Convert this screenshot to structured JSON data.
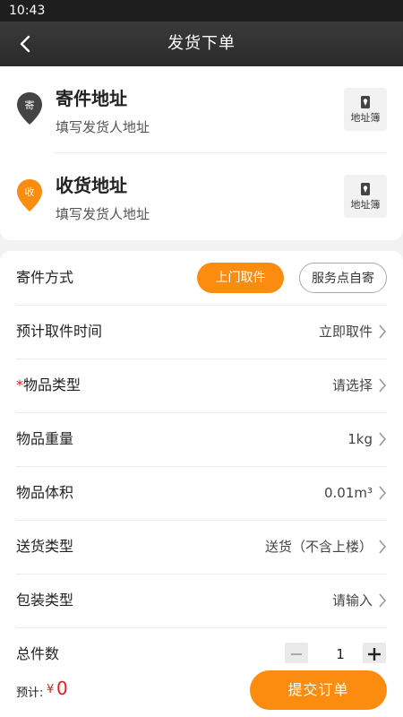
{
  "status_bar": {
    "time": "10:43"
  },
  "nav": {
    "title": "发货下单",
    "back_icon": "back-arrow-icon"
  },
  "sender": {
    "title": "寄件地址",
    "subtitle": "填写发货人地址",
    "pin_char": "寄",
    "pin_color": "#444444",
    "book_label": "地址簿"
  },
  "receiver": {
    "title": "收货地址",
    "subtitle": "填写发货人地址",
    "pin_char": "收",
    "pin_color": "#fb8c10",
    "book_label": "地址簿"
  },
  "form": {
    "ship_method": {
      "label": "寄件方式",
      "options": [
        "上门取件",
        "服务点自寄"
      ],
      "selected": "上门取件"
    },
    "pickup_time": {
      "label": "预计取件时间",
      "value": "立即取件"
    },
    "item_type": {
      "required_mark": "*",
      "label": "物品类型",
      "value": "请选择"
    },
    "weight": {
      "label": "物品重量",
      "value": "1kg"
    },
    "volume": {
      "label": "物品体积",
      "value": "0.01m³"
    },
    "delivery_type": {
      "label": "送货类型",
      "value": "送货（不含上楼）"
    },
    "packaging": {
      "label": "包装类型",
      "value": "请输入"
    },
    "count": {
      "label": "总件数",
      "value": "1",
      "minus": "−",
      "plus": "+"
    }
  },
  "footer": {
    "estimate_label": "预计:",
    "currency": "¥",
    "amount": "0",
    "submit_label": "提交订单"
  },
  "colors": {
    "accent": "#fb8c10",
    "price": "#e02020",
    "nav_bg": "#2e2e2e"
  }
}
